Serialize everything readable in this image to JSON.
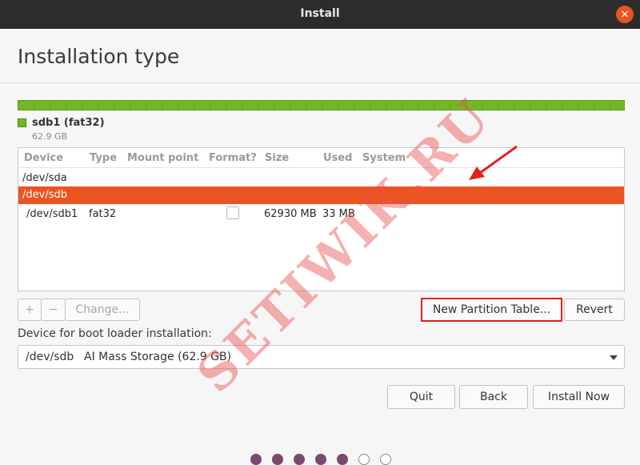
{
  "window": {
    "title": "Install",
    "close_icon": "×"
  },
  "page": {
    "title": "Installation type"
  },
  "partition_bar": {
    "color": "#73b724"
  },
  "legend": {
    "name": "sdb1 (fat32)",
    "size": "62.9 GB"
  },
  "table": {
    "headers": {
      "device": "Device",
      "type": "Type",
      "mount": "Mount point",
      "format": "Format?",
      "size": "Size",
      "used": "Used",
      "system": "System"
    },
    "rows": [
      {
        "device": "/dev/sda"
      },
      {
        "device": "/dev/sdb"
      },
      {
        "device": "/dev/sdb1",
        "type": "fat32",
        "size": "62930 MB",
        "used": "33 MB"
      }
    ]
  },
  "controls": {
    "add": "+",
    "remove": "−",
    "change": "Change...",
    "new_table": "New Partition Table...",
    "revert": "Revert"
  },
  "boot": {
    "label": "Device for boot loader installation:",
    "device": "/dev/sdb",
    "description": "AI Mass Storage (62.9 GB)"
  },
  "actions": {
    "quit": "Quit",
    "back": "Back",
    "install": "Install Now"
  },
  "watermark": "SETIWIK.RU",
  "colors": {
    "accent": "#e95420",
    "highlight": "#e2231a",
    "watermark": "#e85050"
  }
}
